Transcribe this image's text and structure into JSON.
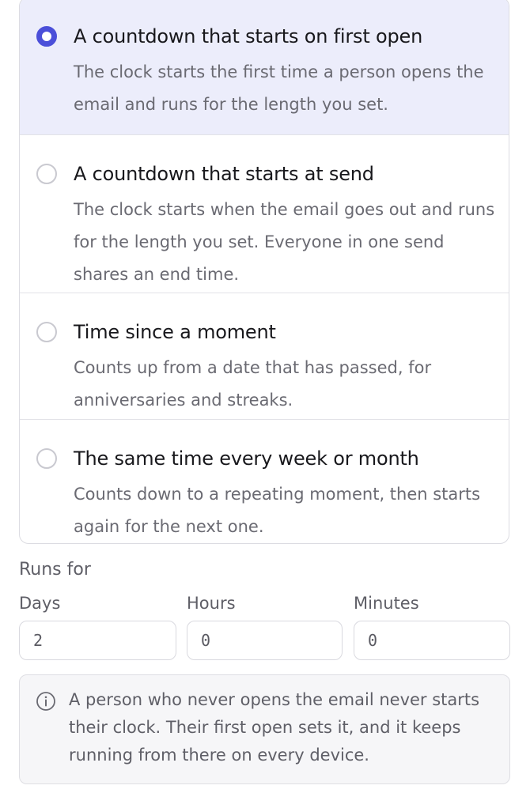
{
  "options": [
    {
      "title": "A countdown that starts on first open",
      "description": "The clock starts the first time a person opens the email and runs for the length you set.",
      "selected": true
    },
    {
      "title": "A countdown that starts at send",
      "description": "The clock starts when the email goes out and runs for the length you set. Everyone in one send shares an end time.",
      "selected": false
    },
    {
      "title": "Time since a moment",
      "description": "Counts up from a date that has passed, for anniversaries and streaks.",
      "selected": false
    },
    {
      "title": "The same time every week or month",
      "description": "Counts down to a repeating moment, then starts again for the next one.",
      "selected": false
    }
  ],
  "runs_for": {
    "label": "Runs for",
    "days": {
      "label": "Days",
      "value": "2"
    },
    "hours": {
      "label": "Hours",
      "value": "0"
    },
    "minutes": {
      "label": "Minutes",
      "value": "0"
    }
  },
  "info": {
    "icon": "info-icon",
    "text": "A person who never opens the email never starts their clock. Their first open sets it, and it keeps running from there on every device."
  },
  "colors": {
    "accent": "#4b4fd9",
    "selected_bg": "#ecedfb"
  }
}
